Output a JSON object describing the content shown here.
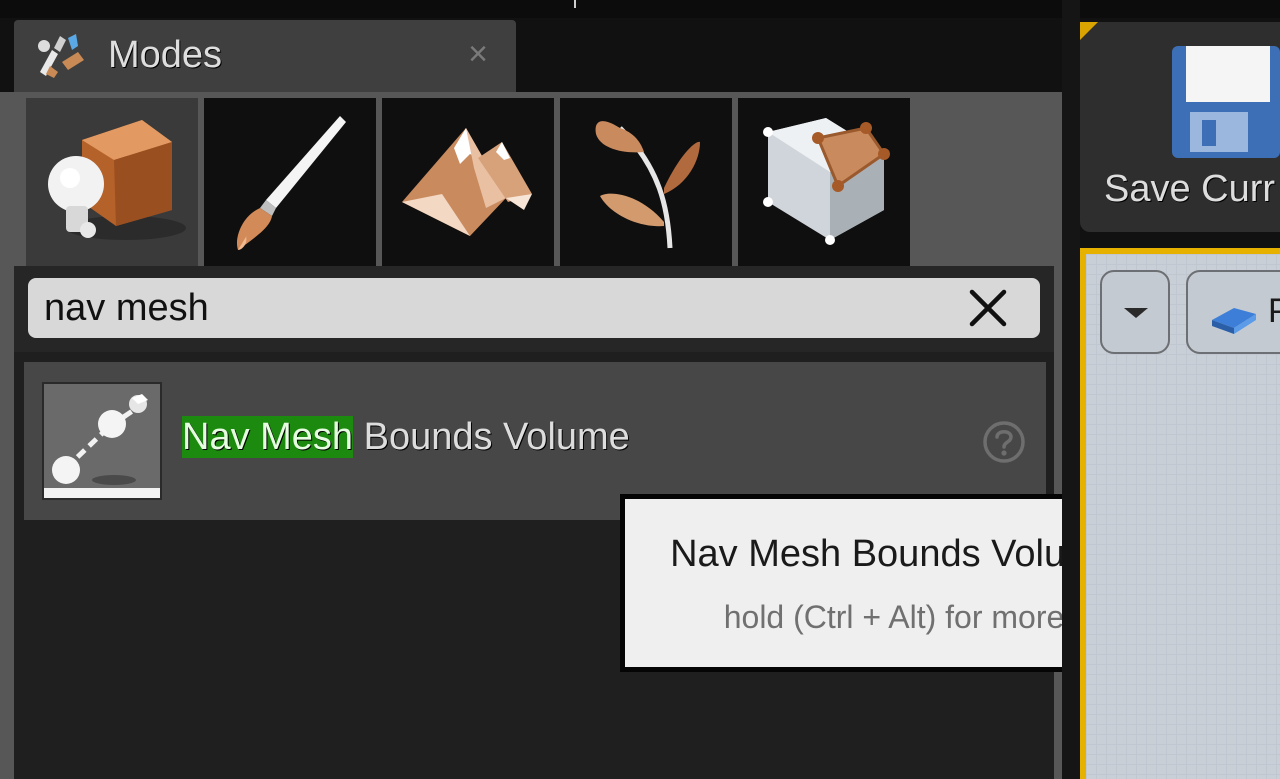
{
  "modes_tab": {
    "title": "Modes",
    "close_glyph": "×",
    "icon": "modes-icon"
  },
  "mode_buttons": [
    {
      "name": "place-mode",
      "icon": "place-mode-icon",
      "active": true
    },
    {
      "name": "paint-mode",
      "icon": "paintbrush-icon",
      "active": false
    },
    {
      "name": "landscape-mode",
      "icon": "mountains-icon",
      "active": false
    },
    {
      "name": "foliage-mode",
      "icon": "leaves-icon",
      "active": false
    },
    {
      "name": "geometry-mode",
      "icon": "geometry-cube-icon",
      "active": false
    }
  ],
  "search": {
    "value": "nav mesh",
    "placeholder": "",
    "clear_glyph": "✕"
  },
  "results": [
    {
      "highlight": "Nav Mesh",
      "rest": " Bounds Volume",
      "thumbnail_icon": "nav-mesh-bounds-volume-icon",
      "help_icon": "help-icon"
    }
  ],
  "tooltip": {
    "title": "Nav Mesh Bounds Volume",
    "subtitle": "hold (Ctrl + Alt) for more"
  },
  "toolbar": {
    "save_label": "Save Curr",
    "save_icon": "floppy-disk-icon"
  },
  "viewport": {
    "view_letter": "P"
  },
  "colors": {
    "highlight": "#1c8a0e",
    "accent": "#e7b100"
  }
}
